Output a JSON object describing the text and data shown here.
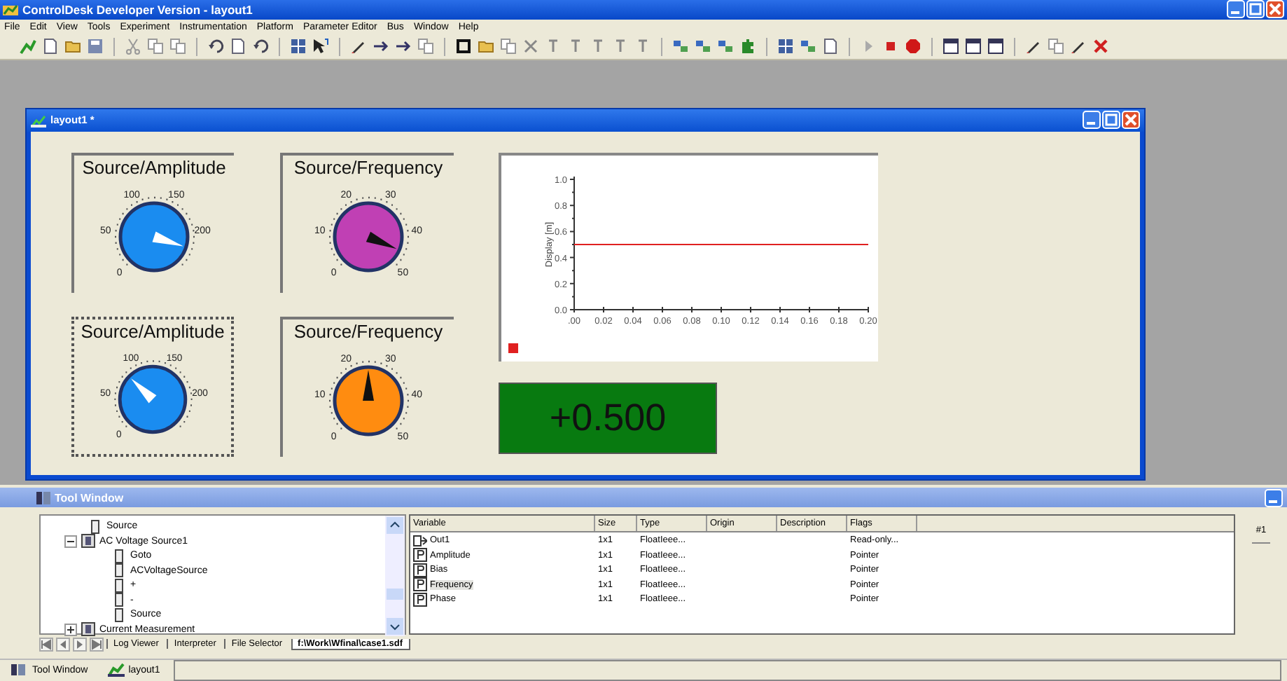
{
  "window": {
    "title": "ControlDesk Developer Version - layout1"
  },
  "menu": [
    "File",
    "Edit",
    "View",
    "Tools",
    "Experiment",
    "Instrumentation",
    "Platform",
    "Parameter Editor",
    "Bus",
    "Window",
    "Help"
  ],
  "layout_window": {
    "title": "layout1 *",
    "gauges": [
      {
        "label": "Source/Amplitude",
        "color": "#1a8cf0",
        "selected": false,
        "scale": [
          "0",
          "50",
          "100",
          "150",
          "200"
        ]
      },
      {
        "label": "Source/Frequency",
        "color": "#c040b4",
        "selected": false,
        "scale": [
          "0",
          "10",
          "20",
          "30",
          "40",
          "50"
        ]
      },
      {
        "label": "Source/Amplitude",
        "color": "#1a8cf0",
        "selected": true,
        "scale": [
          "0",
          "50",
          "100",
          "150",
          "200"
        ]
      },
      {
        "label": "Source/Frequency",
        "color": "#ff8c10",
        "selected": false,
        "scale": [
          "0",
          "10",
          "20",
          "30",
          "40",
          "50"
        ]
      }
    ],
    "plot": {
      "chart_data": {
        "type": "line",
        "ylabel": "Display [m]",
        "x": [
          0,
          0.2
        ],
        "xlim": [
          0,
          0.2
        ],
        "ylim": [
          0,
          1
        ],
        "xticks": [
          {
            "value": 0,
            "label": ".00"
          },
          {
            "value": 0.02,
            "label": "0.02"
          },
          {
            "value": 0.04,
            "label": "0.04"
          },
          {
            "value": 0.06,
            "label": "0.06"
          },
          {
            "value": 0.08,
            "label": "0.08"
          },
          {
            "value": 0.1,
            "label": "0.10"
          },
          {
            "value": 0.12,
            "label": "0.12"
          },
          {
            "value": 0.14,
            "label": "0.14"
          },
          {
            "value": 0.16,
            "label": "0.16"
          },
          {
            "value": 0.18,
            "label": "0.18"
          },
          {
            "value": 0.2,
            "label": "0.20"
          }
        ],
        "yticks": [
          {
            "value": 0,
            "label": "0.0"
          },
          {
            "value": 0.2,
            "label": "0.2"
          },
          {
            "value": 0.4,
            "label": "0.4"
          },
          {
            "value": 0.6,
            "label": "0.6"
          },
          {
            "value": 0.8,
            "label": "0.8"
          },
          {
            "value": 1,
            "label": "1.0"
          }
        ],
        "series": [
          {
            "color": "#e02020",
            "values": [
              0.5,
              0.5
            ]
          }
        ]
      }
    },
    "display": {
      "value": "+0.500"
    }
  },
  "tool_window": {
    "title": "Tool Window",
    "tree": [
      {
        "label": "Source"
      },
      {
        "label": "AC Voltage Source1",
        "expanded": true,
        "children": [
          {
            "label": "Goto"
          },
          {
            "label": "ACVoltageSource"
          },
          {
            "label": "+"
          },
          {
            "label": "-"
          },
          {
            "label": "Source"
          }
        ]
      },
      {
        "label": "Current Measurement",
        "expanded": false
      }
    ],
    "table": {
      "columns": [
        "Variable",
        "Size",
        "Type",
        "Origin",
        "Description",
        "Flags"
      ],
      "rows": [
        {
          "kind": "output",
          "variable": "Out1",
          "size": "1x1",
          "type": "FloatIeee...",
          "flags": "Read-only...",
          "selected": false
        },
        {
          "kind": "parameter",
          "variable": "Amplitude",
          "size": "1x1",
          "type": "FloatIeee...",
          "flags": "Pointer",
          "selected": false
        },
        {
          "kind": "parameter",
          "variable": "Bias",
          "size": "1x1",
          "type": "FloatIeee...",
          "flags": "Pointer",
          "selected": false
        },
        {
          "kind": "parameter",
          "variable": "Frequency",
          "size": "1x1",
          "type": "FloatIeee...",
          "flags": "Pointer",
          "selected": true
        },
        {
          "kind": "parameter",
          "variable": "Phase",
          "size": "1x1",
          "type": "FloatIeee...",
          "flags": "Pointer",
          "selected": false
        }
      ]
    },
    "side_tab": "#1",
    "tabs": [
      {
        "label": "Log Viewer",
        "selected": false
      },
      {
        "label": "Interpreter",
        "selected": false
      },
      {
        "label": "File Selector",
        "selected": false
      },
      {
        "label": "f:\\Work\\Wfinal\\case1.sdf",
        "selected": true
      }
    ]
  },
  "taskbar": [
    {
      "label": "Tool Window",
      "kind": "tool"
    },
    {
      "label": "layout1",
      "kind": "layout"
    }
  ]
}
